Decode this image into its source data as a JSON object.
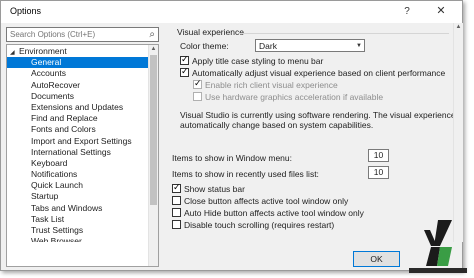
{
  "window": {
    "title": "Options",
    "help_label": "?",
    "close_label": "✕"
  },
  "search": {
    "placeholder": "Search Options (Ctrl+E)",
    "icon": "search-icon"
  },
  "tree": {
    "root": "Environment",
    "items": [
      {
        "label": "General",
        "selected": true
      },
      {
        "label": "Accounts"
      },
      {
        "label": "AutoRecover"
      },
      {
        "label": "Documents"
      },
      {
        "label": "Extensions and Updates"
      },
      {
        "label": "Find and Replace"
      },
      {
        "label": "Fonts and Colors"
      },
      {
        "label": "Import and Export Settings"
      },
      {
        "label": "International Settings"
      },
      {
        "label": "Keyboard"
      },
      {
        "label": "Notifications"
      },
      {
        "label": "Quick Launch"
      },
      {
        "label": "Startup"
      },
      {
        "label": "Tabs and Windows"
      },
      {
        "label": "Task List"
      },
      {
        "label": "Trust Settings"
      },
      {
        "label": "Web Browser"
      }
    ]
  },
  "visual_experience": {
    "header": "Visual experience",
    "color_theme_label": "Color theme:",
    "color_theme_value": "Dark",
    "apply_title_case": {
      "label": "Apply title case styling to menu bar",
      "checked": true
    },
    "auto_adjust": {
      "label": "Automatically adjust visual experience based on client performance",
      "checked": true
    },
    "rich_client": {
      "label": "Enable rich client visual experience",
      "checked": true,
      "disabled": true
    },
    "hw_accel": {
      "label": "Use hardware graphics acceleration if available",
      "checked": false,
      "disabled": true
    },
    "info_line1": "Visual Studio is currently using software rendering.  The visual experience settings",
    "info_line2": "automatically change based on system capabilities."
  },
  "window_menu": {
    "label": "Items to show in Window menu:",
    "value": "10"
  },
  "recent_files": {
    "label": "Items to show in recently used files list:",
    "value": "10"
  },
  "options": {
    "status_bar": {
      "label": "Show status bar",
      "checked": true
    },
    "close_button": {
      "label": "Close button affects active tool window only",
      "checked": false
    },
    "auto_hide": {
      "label": "Auto Hide button affects active tool window only",
      "checked": false
    },
    "touch_scroll": {
      "label": "Disable touch scrolling (requires restart)",
      "checked": false
    }
  },
  "footer": {
    "ok_label": "OK"
  },
  "colors": {
    "selection": "#0078d7",
    "window_bg": "#f0f0f0"
  }
}
